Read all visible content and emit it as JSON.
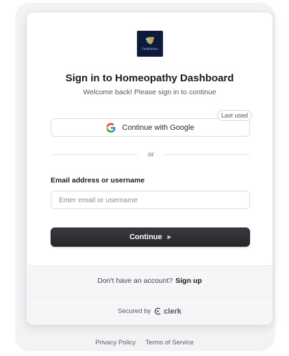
{
  "header": {
    "logo_text": "CodeEditors",
    "title": "Sign in to Homeopathy Dashboard",
    "subtitle": "Welcome back! Please sign in to continue"
  },
  "social": {
    "google_label": "Continue with Google",
    "last_used_badge": "Last used"
  },
  "divider": {
    "text": "or"
  },
  "form": {
    "email_label": "Email address or username",
    "email_placeholder": "Enter email or username",
    "email_value": "",
    "continue_label": "Continue"
  },
  "footer": {
    "signup_prompt": "Don't have an account?",
    "signup_link": "Sign up",
    "secured_by": "Secured by",
    "brand": "clerk"
  },
  "legal": {
    "privacy": "Privacy Policy",
    "terms": "Terms of Service"
  },
  "colors": {
    "primary_button": "#2f2f34",
    "logo_bg": "#0e1a3a",
    "page_bg": "#ffffff"
  },
  "icons": {
    "google": "google-g-icon",
    "continue_arrow": "triangle-right-icon",
    "clerk": "clerk-logo-icon"
  }
}
